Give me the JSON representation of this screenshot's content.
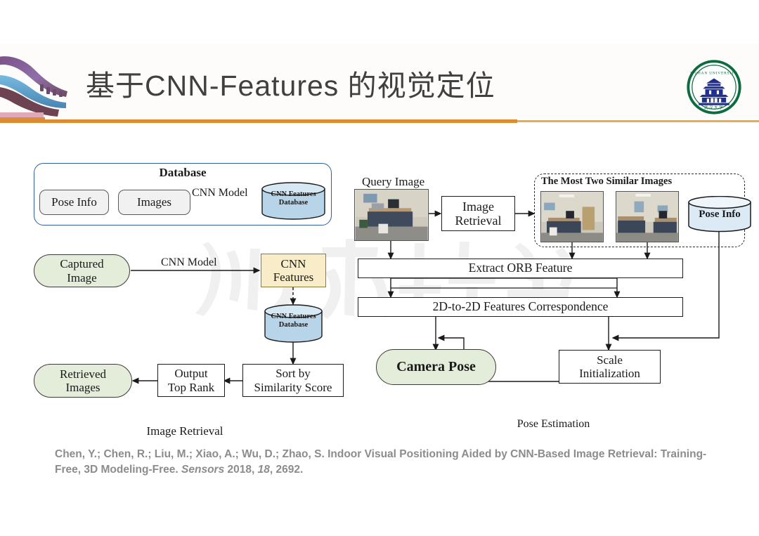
{
  "header": {
    "title": "基于CNN-Features 的视觉定位",
    "logo_alt": "wuhan-university-seal",
    "roof_alt": "chinese-roof-ornament",
    "rule_color": "#e08a2e"
  },
  "watermark": {
    "text": "刘经南大讲堂"
  },
  "colors": {
    "accent_orange": "#e08a2e",
    "db_border_blue": "#2f5f9e",
    "cylinder_fill": "#b8d4e8",
    "pill_green": "#e4ecda",
    "cnn_features_yellow": "#f8edc8",
    "title_gray": "#404040",
    "citation_gray": "#8c8c8c"
  },
  "left_diagram": {
    "caption": "Image Retrieval",
    "database_group": {
      "title": "Database",
      "pose_info": "Pose Info",
      "images": "Images",
      "edge_label": "CNN Model",
      "cnn_features_db": "CNN Features\nDatabase",
      "cnn_features_db_line1": "CNN Features",
      "cnn_features_db_line2": "Database"
    },
    "captured_image": "Captured\nImage",
    "captured_image_line1": "Captured",
    "captured_image_line2": "Image",
    "cnn_model_label": "CNN Model",
    "cnn_features": "CNN\nFeatures",
    "cnn_features_line1": "CNN",
    "cnn_features_line2": "Features",
    "cnn_features_db2_line1": "CNN Features",
    "cnn_features_db2_line2": "Database",
    "sort_by_line1": "Sort by",
    "sort_by_line2": "Similarity Score",
    "output_top_line1": "Output",
    "output_top_line2": "Top Rank",
    "retrieved_line1": "Retrieved",
    "retrieved_line2": "Images"
  },
  "right_diagram": {
    "caption": "Pose Estimation",
    "query_image_label": "Query Image",
    "image_retrieval_line1": "Image",
    "image_retrieval_line2": "Retrieval",
    "similar_group_title": "The Most Two Similar Images",
    "pose_info": "Pose Info",
    "extract_orb": "Extract ORB Feature",
    "correspondence": "2D-to-2D Features Correspondence",
    "camera_pose": "Camera Pose",
    "scale_init_line1": "Scale",
    "scale_init_line2": "Initialization"
  },
  "citation": {
    "part1": "Chen, Y.; Chen, R.; Liu, M.; Xiao, A.; Wu, D.; Zhao, S. Indoor Visual Positioning Aided by CNN-Based Image Retrieval: Training-Free, 3D Modeling-Free. ",
    "journal": "Sensors",
    "part2": " 2018, ",
    "volume": "18",
    "part3": ", 2692."
  }
}
